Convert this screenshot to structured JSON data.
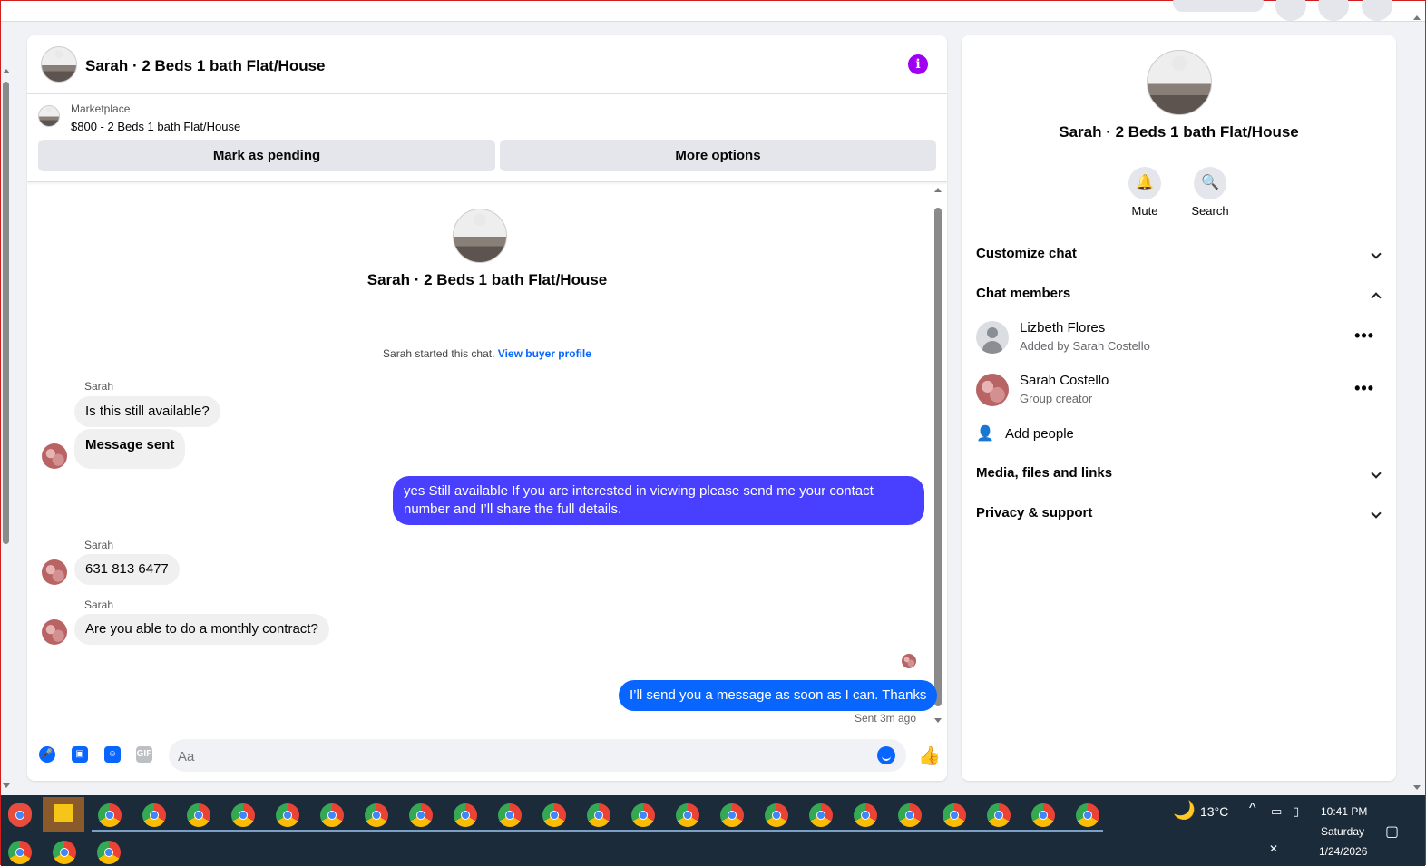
{
  "chat": {
    "title": "Sarah · 2 Beds 1 bath Flat/House",
    "marketplace_label": "Marketplace",
    "listing": "$800 - 2 Beds 1 bath Flat/House",
    "mark_pending": "Mark as pending",
    "more_options": "More options",
    "conversation_title": "Sarah · 2 Beds 1 bath Flat/House",
    "started_text": "Sarah started this chat.",
    "view_buyer": "View buyer profile",
    "messages": [
      {
        "sender": "Sarah",
        "text": "Is this still available?"
      },
      {
        "sender": "",
        "text": "Message sent"
      },
      {
        "sender": "me",
        "text": "yes Still available If you are interested in viewing please send me your contact number and I’ll share the full details."
      },
      {
        "sender": "Sarah",
        "text": "631 813 6477"
      },
      {
        "sender": "Sarah",
        "text": "Are you able to do a monthly contract?"
      },
      {
        "sender": "me",
        "text": "I’ll send you a message as soon as I can. Thanks"
      }
    ],
    "sent_note": "Sent 3m ago",
    "input_placeholder": "Aa",
    "gif_label": "GIF"
  },
  "panel": {
    "title": "Sarah · 2 Beds 1 bath Flat/House",
    "mute": "Mute",
    "search": "Search",
    "customize": "Customize chat",
    "members_header": "Chat members",
    "members": [
      {
        "name": "Lizbeth Flores",
        "sub": "Added by Sarah Costello"
      },
      {
        "name": "Sarah Costello",
        "sub": "Group creator"
      }
    ],
    "add_people": "Add people",
    "media": "Media, files and links",
    "privacy": "Privacy & support",
    "dots": "•••"
  },
  "taskbar": {
    "temp": "13°C",
    "time": "10:41 PM",
    "day": "Saturday",
    "date": "1/24/2026"
  },
  "colors": {
    "accent": "#0866ff",
    "purple_bubble": "#4940ff",
    "info": "#a000f0"
  }
}
